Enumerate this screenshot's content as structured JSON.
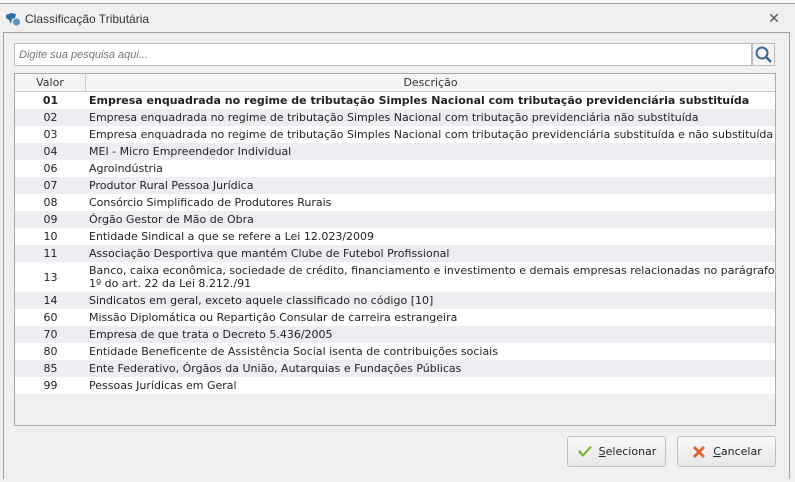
{
  "window": {
    "title": "Classificação Tributária",
    "close_label": "✕"
  },
  "search": {
    "placeholder": "Digite sua pesquisa aqui...",
    "value": ""
  },
  "grid": {
    "headers": {
      "valor": "Valor",
      "descricao": "Descrição"
    },
    "rows": [
      {
        "valor": "01",
        "descricao": "Empresa enquadrada no regime de tributação Simples Nacional com tributação previdenciária substituída",
        "selected": true
      },
      {
        "valor": "02",
        "descricao": "Empresa enquadrada no regime de tributação Simples Nacional com tributação previdenciária não substituída"
      },
      {
        "valor": "03",
        "descricao": "Empresa enquadrada no regime de tributação Simples Nacional com tributação previdenciária substituída e não substituída"
      },
      {
        "valor": "04",
        "descricao": "MEI - Micro Empreendedor Individual"
      },
      {
        "valor": "06",
        "descricao": "Agroindústria"
      },
      {
        "valor": "07",
        "descricao": "Produtor Rural Pessoa Jurídica"
      },
      {
        "valor": "08",
        "descricao": "Consórcio Simplificado de Produtores Rurais"
      },
      {
        "valor": "09",
        "descricao": "Órgão Gestor de Mão de Obra"
      },
      {
        "valor": "10",
        "descricao": "Entidade Sindical a que se refere a Lei 12.023/2009"
      },
      {
        "valor": "11",
        "descricao": "Associação Desportiva que mantém Clube de Futebol Profissional"
      },
      {
        "valor": "13",
        "descricao": "Banco, caixa econômica, sociedade de crédito, financiamento e investimento e demais empresas relacionadas no parágrafo 1º do art. 22 da Lei 8.212./91"
      },
      {
        "valor": "14",
        "descricao": "Sindicatos em geral, exceto aquele classificado no código [10]"
      },
      {
        "valor": "60",
        "descricao": "Missão Diplomática ou Repartição Consular de carreira estrangeira"
      },
      {
        "valor": "70",
        "descricao": "Empresa de que trata o Decreto 5.436/2005"
      },
      {
        "valor": "80",
        "descricao": "Entidade Beneficente de Assistência Social isenta de contribuições sociais"
      },
      {
        "valor": "85",
        "descricao": "Ente Federativo, Órgãos da União, Autarquias e Fundações Públicas"
      },
      {
        "valor": "99",
        "descricao": "Pessoas Jurídicas em Geral"
      }
    ]
  },
  "buttons": {
    "select_first": "S",
    "select_rest": "elecionar",
    "cancel_first": "C",
    "cancel_rest": "ancelar"
  },
  "colors": {
    "check": "#7cb82f",
    "cancel": "#e0602a"
  }
}
